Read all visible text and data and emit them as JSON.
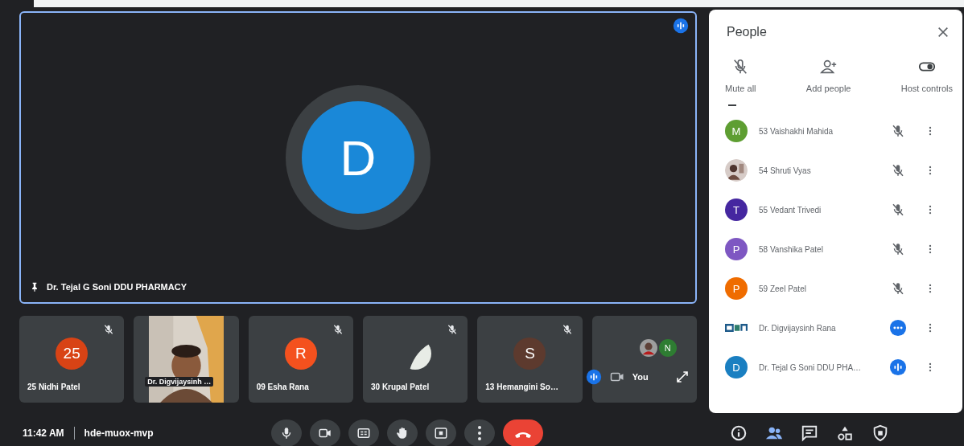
{
  "main_tile": {
    "name": "Dr. Tejal G Soni DDU PHARMACY",
    "initial": "D",
    "color": "#1a88d8",
    "pinned": true,
    "speaking": true
  },
  "tiles": [
    {
      "kind": "avatar",
      "name": "25 Nidhi Patel",
      "initial": "25",
      "color": "#d84315",
      "muted": true
    },
    {
      "kind": "video",
      "name": "Dr. Digvijaysinh …",
      "muted": false
    },
    {
      "kind": "avatar",
      "name": "09 Esha Rana",
      "initial": "R",
      "color": "#f4511e",
      "muted": true
    },
    {
      "name": "30 Krupal Patel",
      "muted": true
    },
    {
      "kind": "avatar",
      "name": "13 Hemangini So…",
      "initial": "S",
      "color": "#5d3a2e",
      "muted": true
    },
    {
      "kind": "self",
      "name": "You",
      "initial": "N",
      "color": "#2e7d32",
      "muted": false
    }
  ],
  "people_panel": {
    "title": "People",
    "actions": [
      {
        "kind": "mute",
        "label": "Mute all"
      },
      {
        "kind": "add",
        "label": "Add people"
      },
      {
        "kind": "host",
        "label": "Host controls"
      }
    ],
    "participants": [
      {
        "kind": "letter",
        "initial": "M",
        "color": "#5e9e32",
        "name": "53 Vaishakhi Mahida",
        "mic": {
          "kind": "muted"
        }
      },
      {
        "name": "54 Shruti Vyas",
        "mic": {
          "kind": "muted"
        }
      },
      {
        "kind": "letter",
        "initial": "T",
        "color": "#4527a0",
        "name": "55 Vedant Trivedi",
        "mic": {
          "kind": "muted"
        }
      },
      {
        "kind": "letter",
        "initial": "P",
        "color": "#7e57c2",
        "name": "58 Vanshika Patel",
        "mic": {
          "kind": "muted"
        }
      },
      {
        "kind": "letter",
        "initial": "P",
        "color": "#ef6c00",
        "name": "59 Zeel Patel",
        "mic": {
          "kind": "muted"
        }
      },
      {
        "kind": "logo",
        "name": "Dr. Digvijaysinh Rana",
        "mic": {
          "kind": "dots"
        }
      },
      {
        "kind": "letter",
        "initial": "D",
        "color": "#1a7fc1",
        "name": "Dr. Tejal G Soni DDU PHA…",
        "mic": {
          "kind": "speaking"
        }
      }
    ]
  },
  "bottom_bar": {
    "time": "11:42 AM",
    "meeting_code": "hde-muox-mvp",
    "controls": [
      {
        "kind": "mic"
      },
      {
        "kind": "camera"
      },
      {
        "kind": "captions"
      },
      {
        "kind": "hand"
      },
      {
        "kind": "present"
      },
      {
        "kind": "more"
      },
      {
        "kind": "end"
      }
    ],
    "side_controls": [
      {
        "kind": "info",
        "selected": false
      },
      {
        "kind": "people",
        "selected": true
      },
      {
        "kind": "chat",
        "selected": false
      },
      {
        "kind": "activities",
        "selected": false
      },
      {
        "kind": "host",
        "selected": false
      }
    ]
  }
}
